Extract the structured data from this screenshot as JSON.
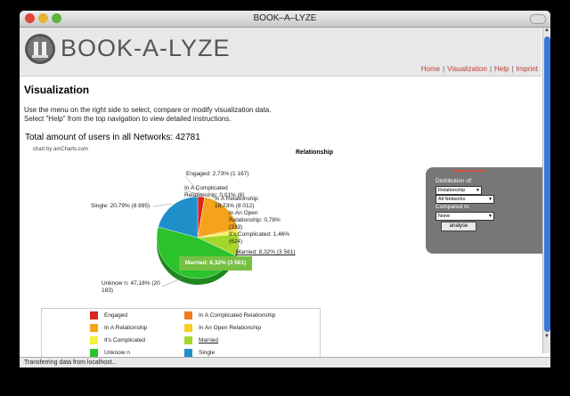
{
  "window": {
    "title": "BOOK–A–LYZE"
  },
  "header": {
    "brand": "BOOK-A-LYZE"
  },
  "nav": {
    "items": [
      "Home",
      "Visualization",
      "Help",
      "Imprint"
    ]
  },
  "page": {
    "title": "Visualization",
    "intro_line1": "Use the menu on the right side to select, compare or modify visualization data.",
    "intro_line2": "Select \"Help\" from the top navigation to view detailed instructions."
  },
  "chart_data": {
    "type": "pie",
    "title": "Total amount of users in all Networks: 42781",
    "heading": "Relationship",
    "credit": "chart by amCharts.com",
    "series": [
      {
        "name": "Engaged",
        "percent": 2.73,
        "count": "1 167",
        "color": "#d7261e",
        "label": "Engaged: 2,73% (1 167)"
      },
      {
        "name": "In A Complicated Relationship",
        "percent": 0.01,
        "count": "6",
        "color": "#f07b1e",
        "label": "In A Complicated Relationship: 0,01% (6)"
      },
      {
        "name": "In A Relationship",
        "percent": 18.73,
        "count": "8 012",
        "color": "#f5a21c",
        "label": "In A Relationship: 18,73% (8 012)"
      },
      {
        "name": "In An Open Relationship",
        "percent": 0.78,
        "count": "333",
        "color": "#f7cd2a",
        "label": "In An Open Relationship: 0,78% (333)"
      },
      {
        "name": "It's Complicated",
        "percent": 1.46,
        "count": "624",
        "color": "#f4f23c",
        "label": "It's Complicated: 1,46% (624)"
      },
      {
        "name": "Married",
        "percent": 8.32,
        "count": "3 561",
        "color": "#a5d62b",
        "label": "Married: 8,32% (3 561)"
      },
      {
        "name": "Unknown",
        "percent": 47.18,
        "count": "20 183",
        "color": "#2bc22b",
        "label": "Unknow n: 47,18% (20 183)"
      },
      {
        "name": "Single",
        "percent": 20.79,
        "count": "8 895",
        "color": "#1f8fc9",
        "label": "Single: 20,79% (8 895)"
      }
    ],
    "tooltip": "Married: 8,32% (3 561)",
    "legend": [
      "Engaged",
      "In A Complicated Relationship",
      "In A Relationship",
      "In An Open Relationship",
      "It's Complicated",
      "Married",
      "Unknow n",
      "Single"
    ]
  },
  "panel": {
    "distribution_label": "Distribution of:",
    "distribution_value": "Relationship",
    "network_value": "All Networks",
    "compared_label": "Compared to",
    "compared_value": "None",
    "analyse_label": "analyse"
  },
  "status": {
    "text": "Transferring data from localhost..."
  }
}
